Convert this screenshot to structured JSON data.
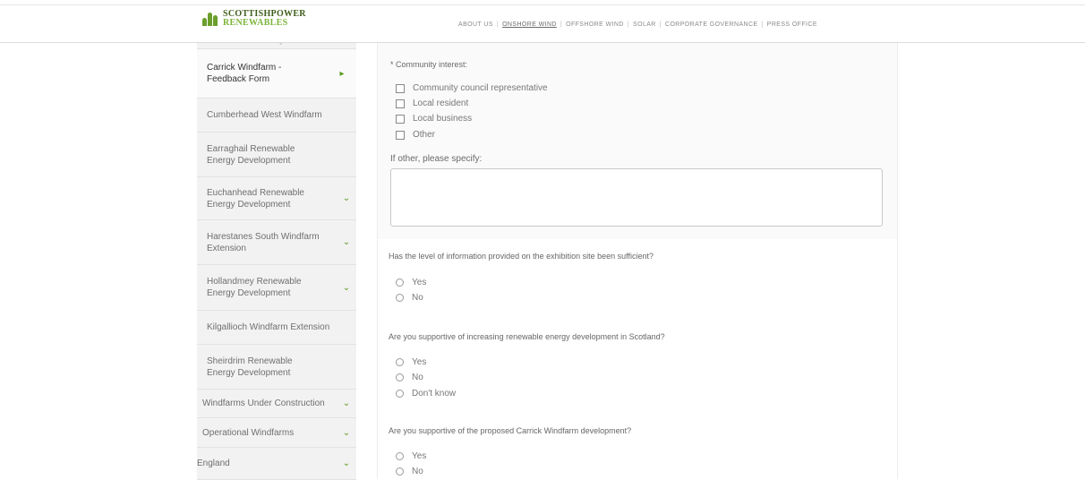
{
  "header": {
    "logo": {
      "line1": "SCOTTISHPOWER",
      "line2": "RENEWABLES"
    },
    "nav": [
      {
        "label": "ABOUT US",
        "active": false
      },
      {
        "label": "ONSHORE WIND",
        "active": true
      },
      {
        "label": "OFFSHORE WIND",
        "active": false
      },
      {
        "label": "SOLAR",
        "active": false
      },
      {
        "label": "CORPORATE GOVERNANCE",
        "active": false
      },
      {
        "label": "PRESS OFFICE",
        "active": false
      }
    ],
    "separator": "|"
  },
  "sidebar": {
    "items": [
      {
        "label": "Carrick Windfarm - FAQs"
      },
      {
        "label": "Carrick Windfarm - Feedback Form",
        "icon": "caret-right-icon"
      },
      {
        "label": "Cumberhead West Windfarm"
      },
      {
        "label": "Earraghail Renewable Energy Development"
      },
      {
        "label": "Euchanhead Renewable Energy Development",
        "icon": "chevron-down-icon"
      },
      {
        "label": "Harestanes South Windfarm Extension",
        "icon": "chevron-down-icon"
      },
      {
        "label": "Hollandmey Renewable Energy Development",
        "icon": "chevron-down-icon"
      },
      {
        "label": "Kilgallioch Windfarm Extension"
      },
      {
        "label": "Sheirdrim Renewable Energy Development"
      },
      {
        "label": "Windfarms Under Construction",
        "icon": "chevron-down-icon"
      },
      {
        "label": "Operational Windfarms",
        "icon": "chevron-down-icon"
      },
      {
        "label": "England",
        "icon": "chevron-down-icon"
      }
    ]
  },
  "form": {
    "community_interest": {
      "label": "* Community interest:",
      "options": [
        "Community council representative",
        "Local resident",
        "Local business",
        "Other"
      ]
    },
    "other_specify": {
      "label": "If other, please specify:",
      "value": ""
    },
    "q1": {
      "text": "Has the level of information provided on the exhibition site been sufficient?",
      "options": [
        "Yes",
        "No"
      ]
    },
    "q2": {
      "text": "Are you supportive of increasing renewable energy development in Scotland?",
      "options": [
        "Yes",
        "No",
        "Don't know"
      ]
    },
    "q3": {
      "text": "Are you supportive of the proposed Carrick Windfarm development?",
      "options": [
        "Yes",
        "No"
      ]
    }
  },
  "colors": {
    "brand_green": "#6b9e2b",
    "chevron_green": "#5a9b1f"
  }
}
